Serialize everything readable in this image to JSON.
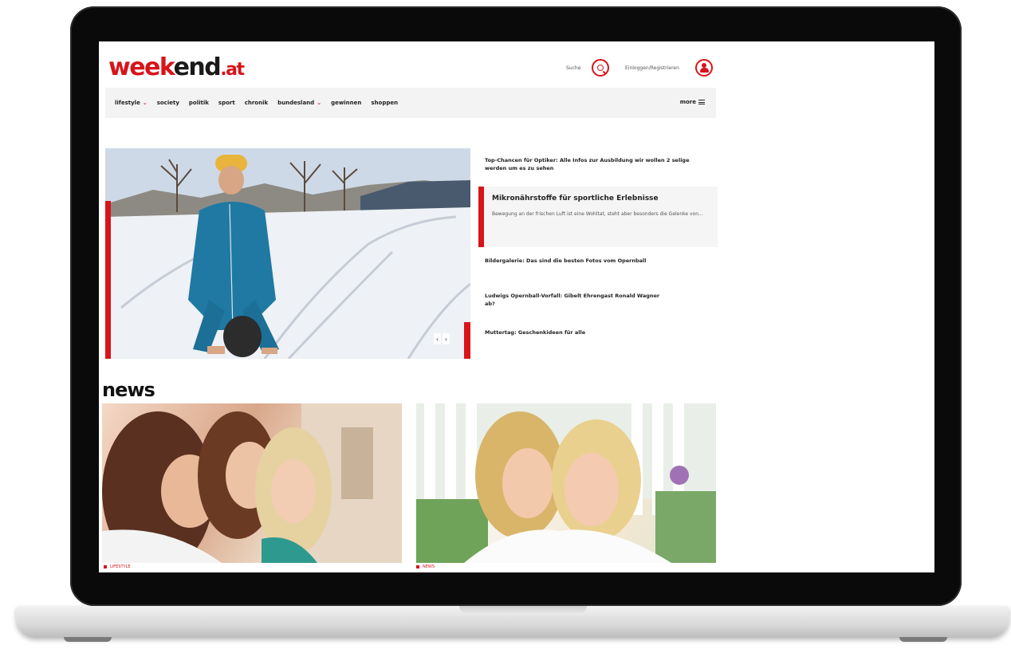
{
  "header": {
    "logo": {
      "part1": "week",
      "part2": "end",
      "part3": ".at"
    },
    "search_label": "Suche",
    "login_label": "Einloggen/Registrieren"
  },
  "nav": {
    "items": [
      {
        "label": "lifestyle",
        "has_dropdown": true
      },
      {
        "label": "society",
        "has_dropdown": false
      },
      {
        "label": "politik",
        "has_dropdown": false
      },
      {
        "label": "sport",
        "has_dropdown": false
      },
      {
        "label": "chronik",
        "has_dropdown": false
      },
      {
        "label": "bundesland",
        "has_dropdown": true
      },
      {
        "label": "gewinnen",
        "has_dropdown": false
      },
      {
        "label": "shoppen",
        "has_dropdown": false
      }
    ],
    "more_label": "more",
    "dropdown_glyph": "⌄"
  },
  "hero": {
    "headlines": [
      "Top-Chancen für Optiker: Alle Infos zur Ausbildung wir wollen 2 selige werden um es zu sehen",
      "Mikronährstoffe für sportliche Erlebnisse",
      "Bildergalerie: Das sind die besten Fotos vom Opernball",
      "Ludwigs Opernball-Vorfall: Gibelt Ehrengast Ronald Wagner ab?",
      "Muttertag: Geschenkideen für alle"
    ],
    "active_teaser": "Bewegung an der frischen Luft ist eine Wohltat, steht aber besonders die Gelenke von...",
    "controls": {
      "prev": "‹",
      "next": "›"
    }
  },
  "news": {
    "heading": "news",
    "cards": [
      {
        "tag": "LIFESTYLE"
      },
      {
        "tag": "NEWS"
      }
    ]
  },
  "colors": {
    "brand_red": "#d7141a",
    "text_dark": "#1a1a1a",
    "nav_bg": "#f3f3f3"
  }
}
